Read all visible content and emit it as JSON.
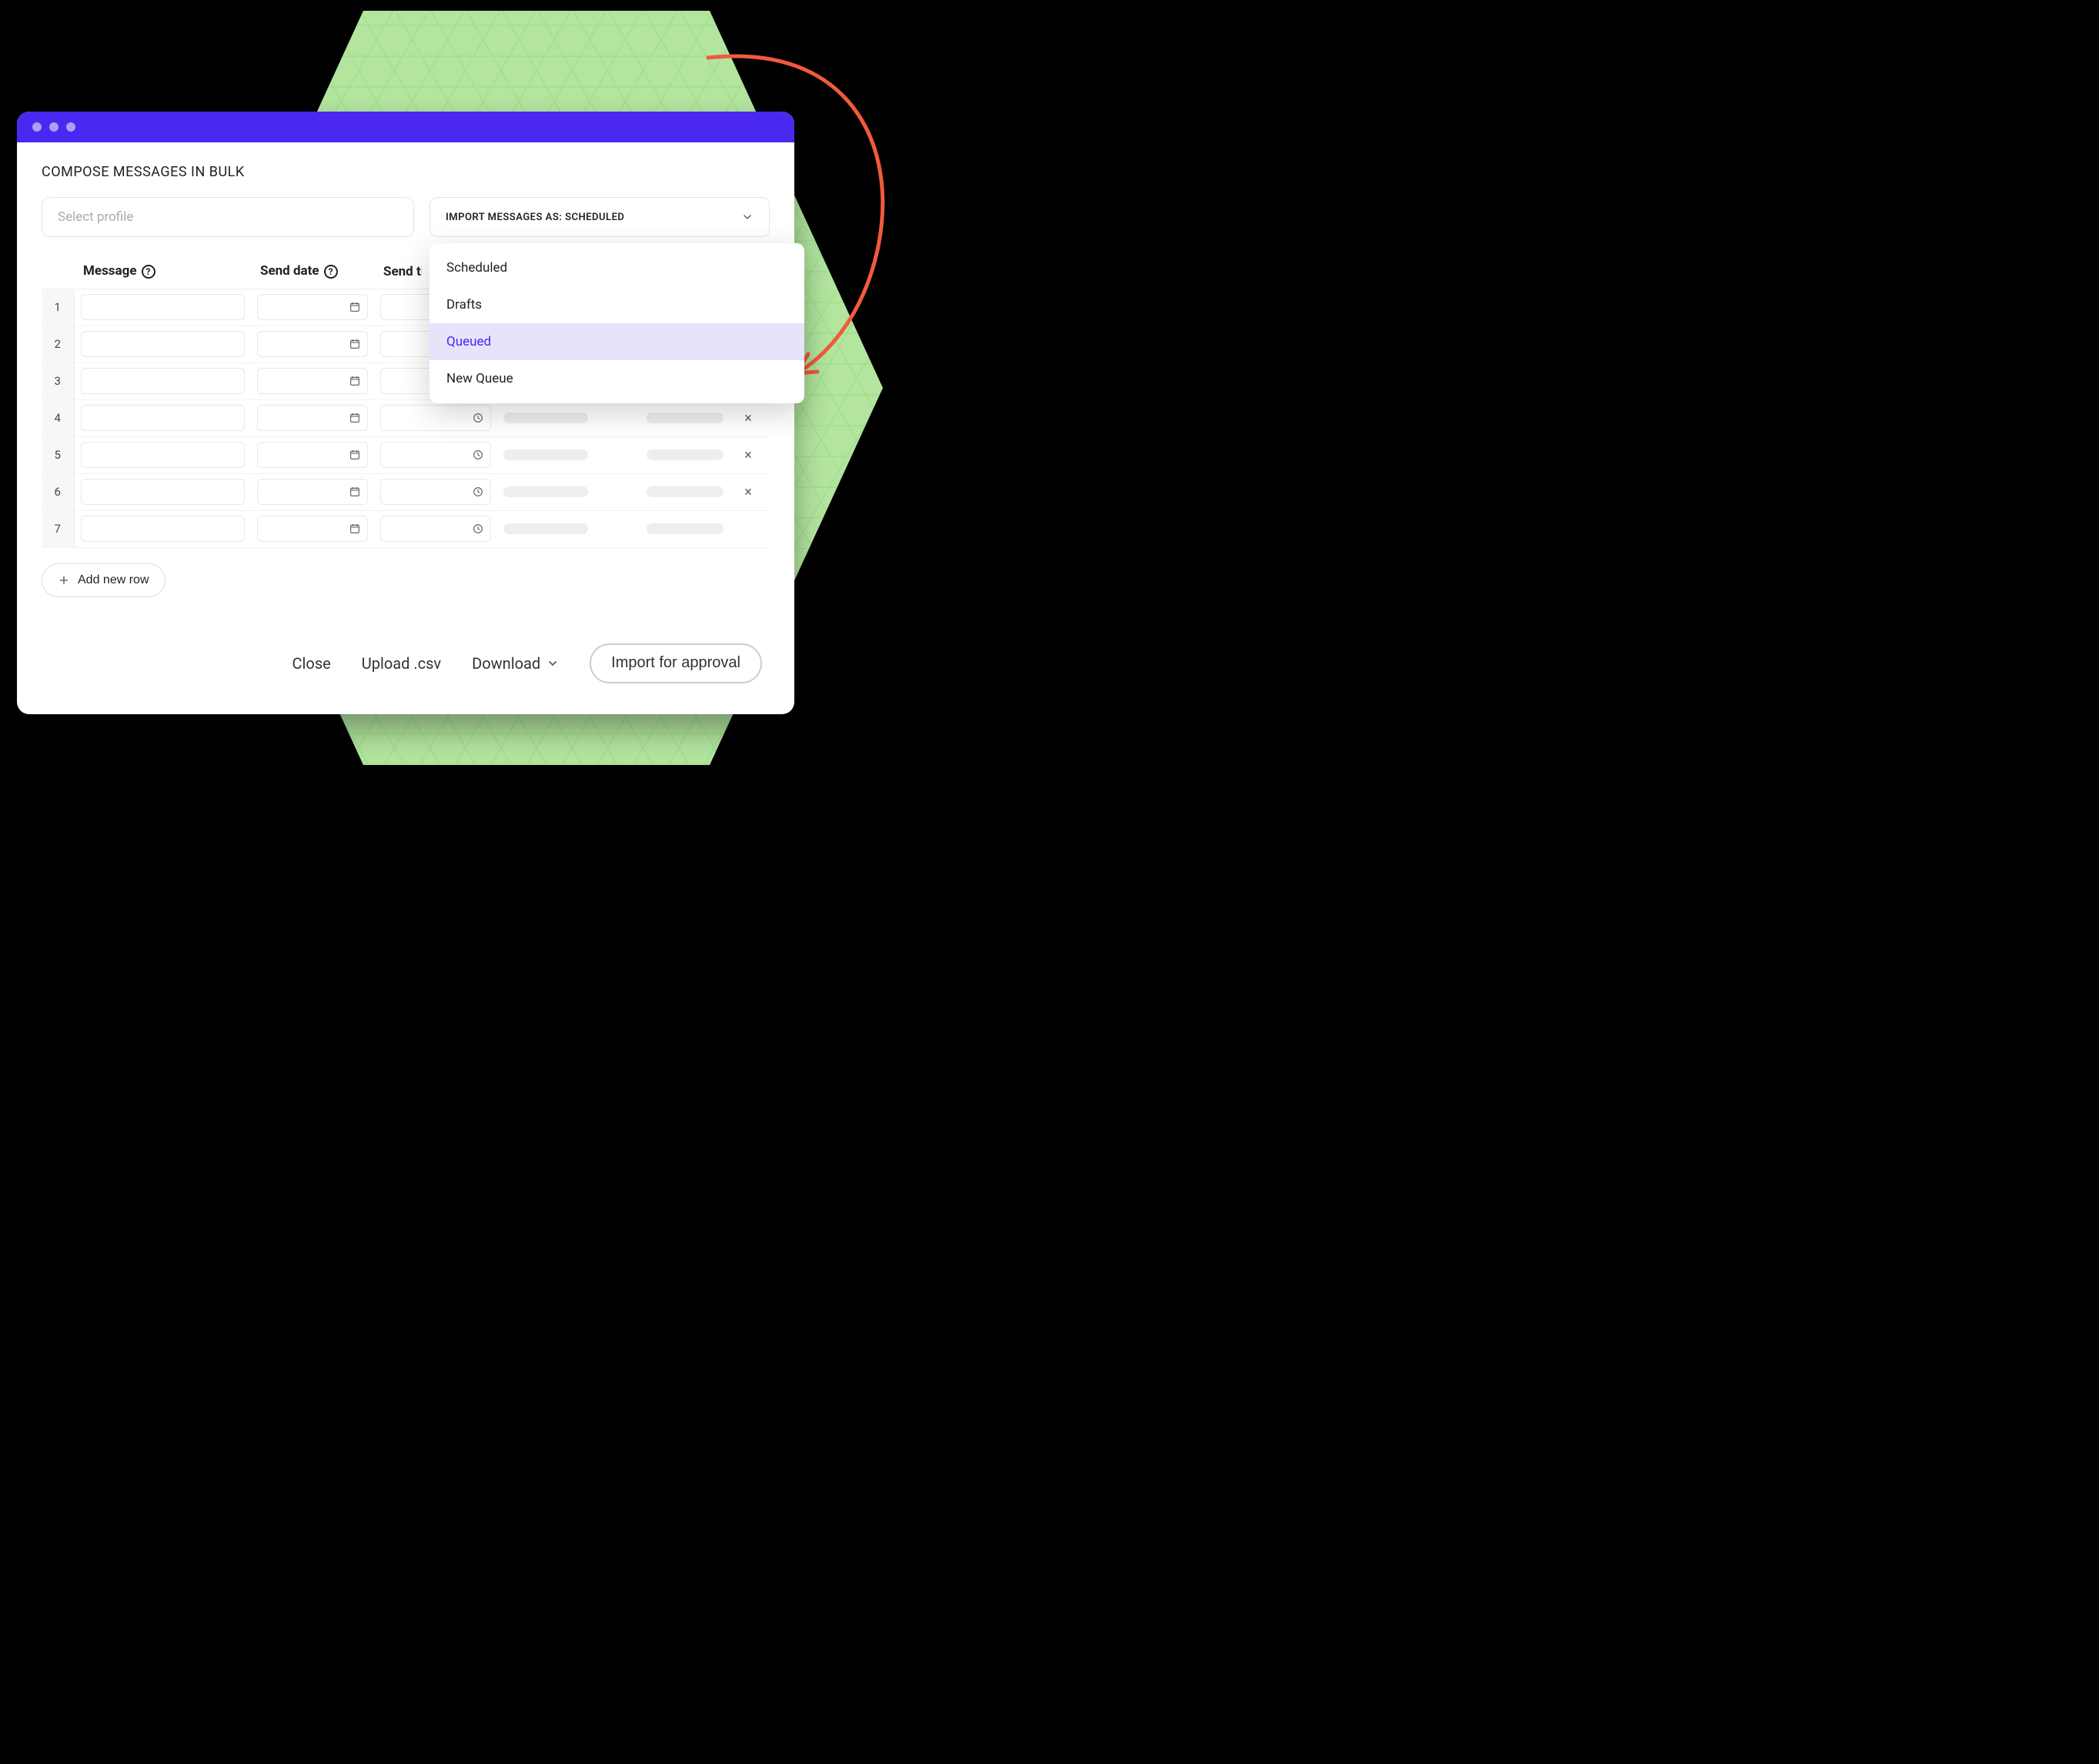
{
  "header": {
    "title": "COMPOSE MESSAGES IN BULK"
  },
  "profile": {
    "placeholder": "Select profile"
  },
  "import": {
    "label_prefix": "IMPORT MESSAGES AS: ",
    "selected": "SCHEDULED",
    "options": [
      {
        "label": "Scheduled",
        "highlight": false
      },
      {
        "label": "Drafts",
        "highlight": false
      },
      {
        "label": "Queued",
        "highlight": true
      },
      {
        "label": "New Queue",
        "highlight": false
      }
    ]
  },
  "columns": {
    "message": "Message",
    "send_date": "Send date",
    "send_time": "Send time"
  },
  "rows": [
    1,
    2,
    3,
    4,
    5,
    6,
    7
  ],
  "actions": {
    "add_row": "Add new row",
    "close": "Close",
    "upload": "Upload .csv",
    "download": "Download",
    "import_approval": "Import for approval"
  },
  "colors": {
    "accent": "#4b28ef",
    "hex_bg": "#b3e59f",
    "arrow": "#f15a3d"
  }
}
